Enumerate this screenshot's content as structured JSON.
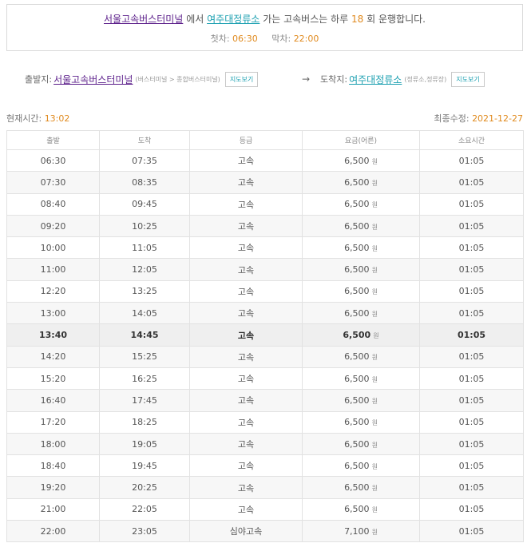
{
  "summary": {
    "origin": "서울고속버스터미널",
    "text_from": "에서",
    "destination": "여주대정류소",
    "text_to": "가는 고속버스는 하루",
    "count": "18",
    "text_end": "회 운행합니다.",
    "first_label": "첫차:",
    "first_time": "06:30",
    "last_label": "막차:",
    "last_time": "22:00"
  },
  "route": {
    "depart_label": "출발지:",
    "depart_name": "서울고속버스터미널",
    "depart_sub": "(버스터미널 > 종합버스터미널)",
    "map_label": "지도보기",
    "arrow": "→",
    "arrive_label": "도착지:",
    "arrive_name": "여주대정류소",
    "arrive_sub": "(정류소,정류장)"
  },
  "meta": {
    "now_label": "현재시간:",
    "now_value": "13:02",
    "updated_label": "최종수정:",
    "updated_value": "2021-12-27"
  },
  "table": {
    "headers": [
      "출발",
      "도착",
      "등급",
      "요금(어른)",
      "소요시간"
    ],
    "currency": "원",
    "rows": [
      {
        "dep": "06:30",
        "arr": "07:35",
        "grade": "고속",
        "fare": "6,500",
        "dur": "01:05"
      },
      {
        "dep": "07:30",
        "arr": "08:35",
        "grade": "고속",
        "fare": "6,500",
        "dur": "01:05"
      },
      {
        "dep": "08:40",
        "arr": "09:45",
        "grade": "고속",
        "fare": "6,500",
        "dur": "01:05"
      },
      {
        "dep": "09:20",
        "arr": "10:25",
        "grade": "고속",
        "fare": "6,500",
        "dur": "01:05"
      },
      {
        "dep": "10:00",
        "arr": "11:05",
        "grade": "고속",
        "fare": "6,500",
        "dur": "01:05"
      },
      {
        "dep": "11:00",
        "arr": "12:05",
        "grade": "고속",
        "fare": "6,500",
        "dur": "01:05"
      },
      {
        "dep": "12:20",
        "arr": "13:25",
        "grade": "고속",
        "fare": "6,500",
        "dur": "01:05"
      },
      {
        "dep": "13:00",
        "arr": "14:05",
        "grade": "고속",
        "fare": "6,500",
        "dur": "01:05"
      },
      {
        "dep": "13:40",
        "arr": "14:45",
        "grade": "고속",
        "fare": "6,500",
        "dur": "01:05"
      },
      {
        "dep": "14:20",
        "arr": "15:25",
        "grade": "고속",
        "fare": "6,500",
        "dur": "01:05"
      },
      {
        "dep": "15:20",
        "arr": "16:25",
        "grade": "고속",
        "fare": "6,500",
        "dur": "01:05"
      },
      {
        "dep": "16:40",
        "arr": "17:45",
        "grade": "고속",
        "fare": "6,500",
        "dur": "01:05"
      },
      {
        "dep": "17:20",
        "arr": "18:25",
        "grade": "고속",
        "fare": "6,500",
        "dur": "01:05"
      },
      {
        "dep": "18:00",
        "arr": "19:05",
        "grade": "고속",
        "fare": "6,500",
        "dur": "01:05"
      },
      {
        "dep": "18:40",
        "arr": "19:45",
        "grade": "고속",
        "fare": "6,500",
        "dur": "01:05"
      },
      {
        "dep": "19:20",
        "arr": "20:25",
        "grade": "고속",
        "fare": "6,500",
        "dur": "01:05"
      },
      {
        "dep": "21:00",
        "arr": "22:05",
        "grade": "고속",
        "fare": "6,500",
        "dur": "01:05"
      },
      {
        "dep": "22:00",
        "arr": "23:05",
        "grade": "심야고속",
        "fare": "7,100",
        "dur": "01:05"
      }
    ]
  }
}
